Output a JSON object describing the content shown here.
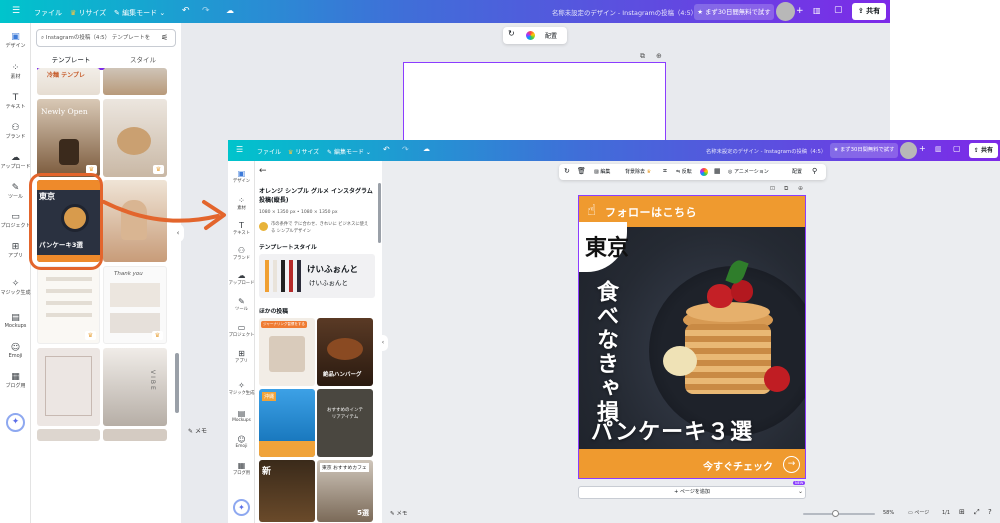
{
  "bg_editor": {
    "menu": {
      "file": "ファイル",
      "resize": "リサイズ",
      "edit_mode": "編集モード"
    },
    "doc_title": "名称未設定のデザイン - Instagramの投稿（4:5）",
    "trial": "まず30日間無料で試す",
    "share": "共有",
    "nav": [
      {
        "label": "デザイン",
        "icon": "design-icon"
      },
      {
        "label": "素材",
        "icon": "elements-icon"
      },
      {
        "label": "テキスト",
        "icon": "text-icon"
      },
      {
        "label": "ブランド",
        "icon": "brand-icon"
      },
      {
        "label": "アップロード",
        "icon": "upload-icon"
      },
      {
        "label": "ツール",
        "icon": "tools-icon"
      },
      {
        "label": "プロジェクト",
        "icon": "folder-icon"
      },
      {
        "label": "アプリ",
        "icon": "apps-icon"
      },
      {
        "label": "マジック生成",
        "icon": "magic-icon"
      },
      {
        "label": "Mockups",
        "icon": "mockups-icon"
      },
      {
        "label": "Emoji",
        "icon": "emoji-icon"
      },
      {
        "label": "ブログ用",
        "icon": "blog-icon"
      }
    ],
    "search_placeholder": "Instagramの投稿（4:5） テンプレートを",
    "tabs": {
      "template": "テンプレート",
      "style": "スタイル"
    },
    "thumb_texts": {
      "t1": "冷麺 テンプレ",
      "t2": "Newly Open",
      "t3": "東京",
      "t4": "Thank you",
      "t5": "VIBE",
      "t6": "フォローはこちら",
      "t7": "パンケーキ3選"
    },
    "float_toolbar": {
      "layout": "配置"
    },
    "memo": "メモ"
  },
  "fg_editor": {
    "menu": {
      "file": "ファイル",
      "resize": "リサイズ",
      "edit_mode": "編集モード"
    },
    "doc_title": "名称未設定のデザイン - Instagramの投稿（4:5）",
    "trial": "まず30日間無料で試す",
    "share": "共有",
    "nav": [
      {
        "label": "デザイン",
        "icon": "design-icon"
      },
      {
        "label": "素材",
        "icon": "elements-icon"
      },
      {
        "label": "テキスト",
        "icon": "text-icon"
      },
      {
        "label": "ブランド",
        "icon": "brand-icon"
      },
      {
        "label": "アップロード",
        "icon": "upload-icon"
      },
      {
        "label": "ツール",
        "icon": "tools-icon"
      },
      {
        "label": "プロジェクト",
        "icon": "folder-icon"
      },
      {
        "label": "アプリ",
        "icon": "apps-icon"
      },
      {
        "label": "マジック生成",
        "icon": "magic-icon"
      },
      {
        "label": "Mockups",
        "icon": "mockups-icon"
      },
      {
        "label": "Emoji",
        "icon": "emoji-icon"
      },
      {
        "label": "ブログ用",
        "icon": "blog-icon"
      }
    ],
    "template": {
      "title": "オレンジ シンプル グルメ インスタグラム 投稿(縦長)",
      "size": "1080 × 1350 px • 1080 × 1350 px",
      "desc": "市の条件で テに合わせ、きれいに ビジネスに使える シンプルデザイン",
      "style_header": "テンプレートスタイル",
      "style_text_1": "けいふぉんと",
      "style_text_2": "けいふぉんと",
      "more_header": "ほかの投稿"
    },
    "more_thumbs": {
      "a": "ジャーナリング習慣をする",
      "b": "絶品ハンバーグ",
      "c": "沖縄",
      "d": "おすすめのインテリアアイテム",
      "e": "新",
      "f": "東京 おすすめカフェ",
      "f2": "5選"
    },
    "toolbar": {
      "edit": "編集",
      "bg_remove": "背景除去",
      "flip": "反転",
      "animation": "アニメーション",
      "position": "配置"
    },
    "post": {
      "follow": "フォローはこちら",
      "city": "東京",
      "vertical": "食べなきゃ損",
      "bottom": "パンケーキ３選",
      "cta": "今すぐチェック"
    },
    "add_page": "+ ページを追加",
    "new_badge": "NEW",
    "memo": "メモ",
    "zoom": "58%",
    "page_label": "ページ",
    "page_count": "1/1"
  }
}
